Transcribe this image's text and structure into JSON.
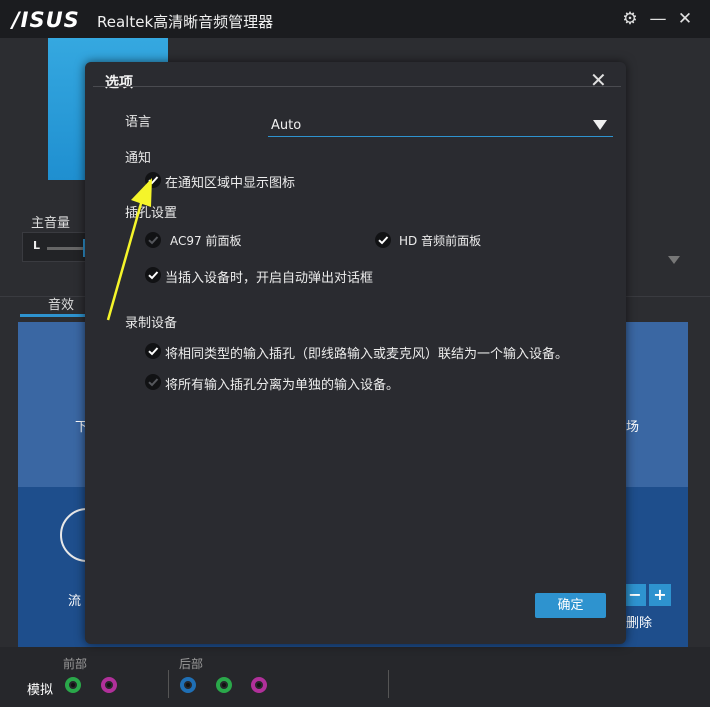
{
  "app": {
    "logo": "/ISUS",
    "title": "Realtek高清晰音频管理器"
  },
  "window_controls": {
    "settings_glyph": "⚙",
    "minimize_glyph": "—",
    "close_glyph": "✕"
  },
  "background": {
    "master_volume_label": "主音量",
    "balance_left": "L",
    "tab_effects": "音效",
    "icon_label_1": "下",
    "icon_label_2": "场",
    "icon_label_3": "流",
    "delete_label": "删除",
    "minus_glyph": "−",
    "plus_glyph": "+",
    "front_label": "前部",
    "rear_label": "后部",
    "analog_label": "模拟"
  },
  "dialog": {
    "title": "选项",
    "close_glyph": "✕",
    "language_label": "语言",
    "language_value": "Auto",
    "notify_section": "通知",
    "notify_show_icon": "在通知区域中显示图标",
    "jack_section": "插孔设置",
    "ac97_label": "AC97 前面板",
    "hd_label": "HD 音频前面板",
    "popup_label": "当插入设备时，开启自动弹出对话框",
    "record_section": "录制设备",
    "record_combine": "将相同类型的输入插孔（即线路输入或麦克风）联结为一个输入设备。",
    "record_separate": "将所有输入插孔分离为单独的输入设备。",
    "ok_label": "确定"
  },
  "colors": {
    "accent": "#2e93cf",
    "jack_green": "#2aa84a",
    "jack_pink": "#b0309a",
    "jack_blue": "#1f6fb5",
    "annotation_arrow": "#f5f52a"
  }
}
